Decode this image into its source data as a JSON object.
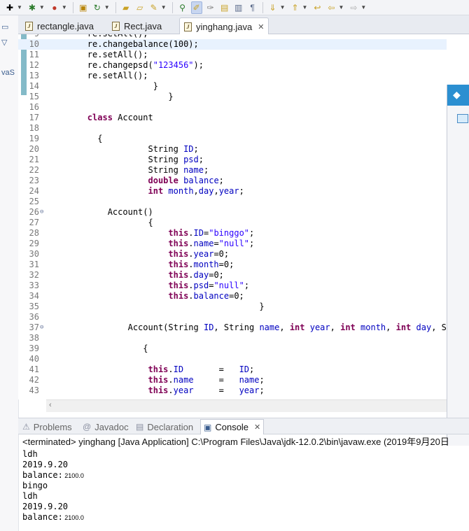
{
  "toolbar": {
    "icons": [
      "new-icon",
      "debug-icon",
      "run-icon",
      "package-icon",
      "refresh-icon",
      "open-folder-icon",
      "open-file-icon",
      "wrench-icon",
      "pin-icon",
      "highlight-icon",
      "brush-icon",
      "edit-icon",
      "file-icon",
      "paragraph-icon",
      "down-arrow-icon",
      "up-arrow-icon",
      "back-icon",
      "back-arrow-icon",
      "forward-arrow-icon"
    ]
  },
  "left_strip": {
    "label": "vaS"
  },
  "editor_tabs": [
    {
      "label": "rectangle.java",
      "active": false
    },
    {
      "label": "Rect.java",
      "active": false
    },
    {
      "label": "yinghang.java",
      "active": true,
      "close": "✕"
    }
  ],
  "code_lines": [
    {
      "n": "9",
      "segs": [
        {
          "t": "        re.setAll();",
          "c": ""
        }
      ]
    },
    {
      "n": "10",
      "segs": [
        {
          "t": "        re.changebalance(100);",
          "c": ""
        }
      ],
      "current": true
    },
    {
      "n": "11",
      "segs": [
        {
          "t": "        re.setAll();",
          "c": ""
        }
      ]
    },
    {
      "n": "12",
      "segs": [
        {
          "t": "        re.changepsd(",
          "c": ""
        },
        {
          "t": "\"123456\"",
          "c": "str"
        },
        {
          "t": ");",
          "c": ""
        }
      ]
    },
    {
      "n": "13",
      "segs": [
        {
          "t": "        re.setAll();",
          "c": ""
        }
      ]
    },
    {
      "n": "14",
      "segs": [
        {
          "t": "                     }",
          "c": ""
        }
      ]
    },
    {
      "n": "15",
      "segs": [
        {
          "t": "                        }",
          "c": ""
        }
      ]
    },
    {
      "n": "16",
      "segs": [
        {
          "t": "",
          "c": ""
        }
      ]
    },
    {
      "n": "17",
      "segs": [
        {
          "t": "        ",
          "c": ""
        },
        {
          "t": "class",
          "c": "kw"
        },
        {
          "t": " Account",
          "c": ""
        }
      ]
    },
    {
      "n": "18",
      "segs": [
        {
          "t": "",
          "c": ""
        }
      ]
    },
    {
      "n": "19",
      "segs": [
        {
          "t": "          {",
          "c": ""
        }
      ]
    },
    {
      "n": "20",
      "segs": [
        {
          "t": "                    String ",
          "c": ""
        },
        {
          "t": "ID",
          "c": "fld"
        },
        {
          "t": ";",
          "c": ""
        }
      ]
    },
    {
      "n": "21",
      "segs": [
        {
          "t": "                    String ",
          "c": ""
        },
        {
          "t": "psd",
          "c": "fld"
        },
        {
          "t": ";",
          "c": ""
        }
      ]
    },
    {
      "n": "22",
      "segs": [
        {
          "t": "                    String ",
          "c": ""
        },
        {
          "t": "name",
          "c": "fld"
        },
        {
          "t": ";",
          "c": ""
        }
      ]
    },
    {
      "n": "23",
      "segs": [
        {
          "t": "                    ",
          "c": ""
        },
        {
          "t": "double",
          "c": "kw"
        },
        {
          "t": " ",
          "c": ""
        },
        {
          "t": "balance",
          "c": "fld"
        },
        {
          "t": ";",
          "c": ""
        }
      ]
    },
    {
      "n": "24",
      "segs": [
        {
          "t": "                    ",
          "c": ""
        },
        {
          "t": "int",
          "c": "kw"
        },
        {
          "t": " ",
          "c": ""
        },
        {
          "t": "month",
          "c": "fld"
        },
        {
          "t": ",",
          "c": ""
        },
        {
          "t": "day",
          "c": "fld"
        },
        {
          "t": ",",
          "c": ""
        },
        {
          "t": "year",
          "c": "fld"
        },
        {
          "t": ";",
          "c": ""
        }
      ]
    },
    {
      "n": "25",
      "segs": [
        {
          "t": "",
          "c": ""
        }
      ]
    },
    {
      "n": "26",
      "fold": true,
      "segs": [
        {
          "t": "            Account()",
          "c": ""
        }
      ]
    },
    {
      "n": "27",
      "segs": [
        {
          "t": "                    {",
          "c": ""
        }
      ]
    },
    {
      "n": "28",
      "segs": [
        {
          "t": "                        ",
          "c": ""
        },
        {
          "t": "this",
          "c": "kw"
        },
        {
          "t": ".",
          "c": ""
        },
        {
          "t": "ID",
          "c": "fld"
        },
        {
          "t": "=",
          "c": ""
        },
        {
          "t": "\"binggo\"",
          "c": "str"
        },
        {
          "t": ";",
          "c": ""
        }
      ]
    },
    {
      "n": "29",
      "segs": [
        {
          "t": "                        ",
          "c": ""
        },
        {
          "t": "this",
          "c": "kw"
        },
        {
          "t": ".",
          "c": ""
        },
        {
          "t": "name",
          "c": "fld"
        },
        {
          "t": "=",
          "c": ""
        },
        {
          "t": "\"null\"",
          "c": "str"
        },
        {
          "t": ";",
          "c": ""
        }
      ]
    },
    {
      "n": "30",
      "segs": [
        {
          "t": "                        ",
          "c": ""
        },
        {
          "t": "this",
          "c": "kw"
        },
        {
          "t": ".",
          "c": ""
        },
        {
          "t": "year",
          "c": "fld"
        },
        {
          "t": "=0;",
          "c": ""
        }
      ]
    },
    {
      "n": "31",
      "segs": [
        {
          "t": "                        ",
          "c": ""
        },
        {
          "t": "this",
          "c": "kw"
        },
        {
          "t": ".",
          "c": ""
        },
        {
          "t": "month",
          "c": "fld"
        },
        {
          "t": "=0;",
          "c": ""
        }
      ]
    },
    {
      "n": "32",
      "segs": [
        {
          "t": "                        ",
          "c": ""
        },
        {
          "t": "this",
          "c": "kw"
        },
        {
          "t": ".",
          "c": ""
        },
        {
          "t": "day",
          "c": "fld"
        },
        {
          "t": "=0;",
          "c": ""
        }
      ]
    },
    {
      "n": "33",
      "segs": [
        {
          "t": "                        ",
          "c": ""
        },
        {
          "t": "this",
          "c": "kw"
        },
        {
          "t": ".",
          "c": ""
        },
        {
          "t": "psd",
          "c": "fld"
        },
        {
          "t": "=",
          "c": ""
        },
        {
          "t": "\"null\"",
          "c": "str"
        },
        {
          "t": ";",
          "c": ""
        }
      ]
    },
    {
      "n": "34",
      "segs": [
        {
          "t": "                        ",
          "c": ""
        },
        {
          "t": "this",
          "c": "kw"
        },
        {
          "t": ".",
          "c": ""
        },
        {
          "t": "balance",
          "c": "fld"
        },
        {
          "t": "=0;",
          "c": ""
        }
      ]
    },
    {
      "n": "35",
      "segs": [
        {
          "t": "                                          }",
          "c": ""
        }
      ]
    },
    {
      "n": "36",
      "segs": [
        {
          "t": "",
          "c": ""
        }
      ]
    },
    {
      "n": "37",
      "fold": true,
      "segs": [
        {
          "t": "                Account(String ",
          "c": ""
        },
        {
          "t": "ID",
          "c": "fld"
        },
        {
          "t": ", String ",
          "c": ""
        },
        {
          "t": "name",
          "c": "fld"
        },
        {
          "t": ", ",
          "c": ""
        },
        {
          "t": "int",
          "c": "kw"
        },
        {
          "t": " ",
          "c": ""
        },
        {
          "t": "year",
          "c": "fld"
        },
        {
          "t": ", ",
          "c": ""
        },
        {
          "t": "int",
          "c": "kw"
        },
        {
          "t": " ",
          "c": ""
        },
        {
          "t": "month",
          "c": "fld"
        },
        {
          "t": ", ",
          "c": ""
        },
        {
          "t": "int",
          "c": "kw"
        },
        {
          "t": " ",
          "c": ""
        },
        {
          "t": "day",
          "c": "fld"
        },
        {
          "t": ", Str",
          "c": ""
        }
      ]
    },
    {
      "n": "38",
      "segs": [
        {
          "t": "",
          "c": ""
        }
      ]
    },
    {
      "n": "39",
      "segs": [
        {
          "t": "                   {",
          "c": ""
        }
      ]
    },
    {
      "n": "40",
      "segs": [
        {
          "t": "",
          "c": ""
        }
      ]
    },
    {
      "n": "41",
      "segs": [
        {
          "t": "                    ",
          "c": ""
        },
        {
          "t": "this",
          "c": "kw"
        },
        {
          "t": ".",
          "c": ""
        },
        {
          "t": "ID",
          "c": "fld"
        },
        {
          "t": "       =   ",
          "c": ""
        },
        {
          "t": "ID",
          "c": "fld"
        },
        {
          "t": ";",
          "c": ""
        }
      ]
    },
    {
      "n": "42",
      "segs": [
        {
          "t": "                    ",
          "c": ""
        },
        {
          "t": "this",
          "c": "kw"
        },
        {
          "t": ".",
          "c": ""
        },
        {
          "t": "name",
          "c": "fld"
        },
        {
          "t": "     =   ",
          "c": ""
        },
        {
          "t": "name",
          "c": "fld"
        },
        {
          "t": ";",
          "c": ""
        }
      ]
    },
    {
      "n": "43",
      "segs": [
        {
          "t": "                    ",
          "c": ""
        },
        {
          "t": "this",
          "c": "kw"
        },
        {
          "t": ".",
          "c": ""
        },
        {
          "t": "year",
          "c": "fld"
        },
        {
          "t": "     =   ",
          "c": ""
        },
        {
          "t": "year",
          "c": "fld"
        },
        {
          "t": ";",
          "c": ""
        }
      ]
    }
  ],
  "bottom_tabs": [
    {
      "label": "Problems",
      "icon": "problems-icon",
      "active": false
    },
    {
      "label": "Javadoc",
      "icon": "at-icon",
      "active": false
    },
    {
      "label": "Declaration",
      "icon": "declaration-icon",
      "active": false
    },
    {
      "label": "Console",
      "icon": "console-icon",
      "active": true,
      "close": "✕"
    }
  ],
  "console": {
    "header": "<terminated> yinghang [Java Application] C:\\Program Files\\Java\\jdk-12.0.2\\bin\\javaw.exe (2019年9月20日 ",
    "lines": [
      {
        "main": "ldh",
        "small": ""
      },
      {
        "main": "2019.9.20",
        "small": ""
      },
      {
        "main": "balance:",
        "small": " 2100.0"
      },
      {
        "main": "bingo",
        "small": ""
      },
      {
        "main": "ldh",
        "small": ""
      },
      {
        "main": "2019.9.20",
        "small": ""
      },
      {
        "main": "balance:",
        "small": " 2100.0"
      }
    ]
  },
  "colors": {
    "keyword": "#7f0055",
    "field": "#0000c0",
    "string": "#2a00ff",
    "current_line": "#e8f2fe",
    "change_bar": "#5ba3b5",
    "accent_tab": "#2b8fd1"
  }
}
